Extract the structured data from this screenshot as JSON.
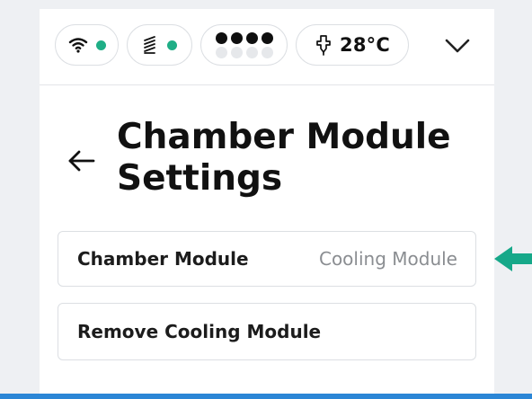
{
  "status_bar": {
    "temperature": "28°C",
    "wifi_status_color": "#1fae86",
    "module_status_color": "#1fae86",
    "cells_filled": 4,
    "cells_total": 8
  },
  "page": {
    "title": "Chamber Module Settings"
  },
  "settings": {
    "row1": {
      "label": "Chamber Module",
      "value": "Cooling Module"
    },
    "row2": {
      "label": "Remove Cooling Module"
    }
  },
  "colors": {
    "accent_green": "#1fae86",
    "pointer_arrow": "#16a889",
    "bottom_line": "#2b86d6"
  }
}
